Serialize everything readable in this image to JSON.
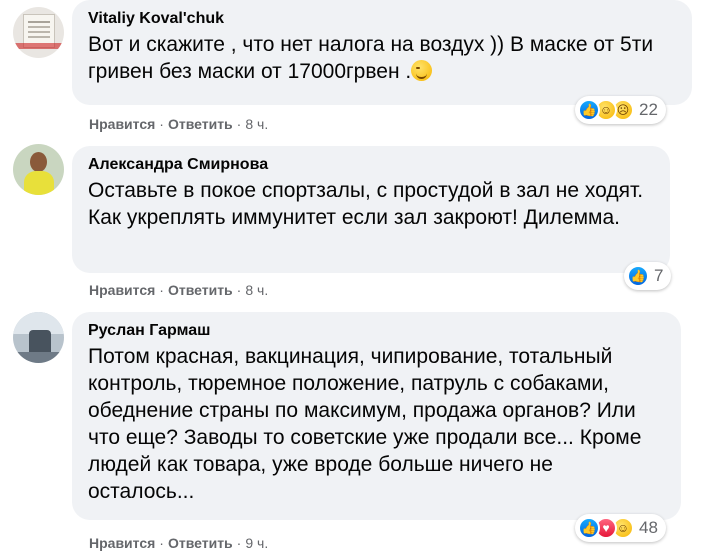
{
  "comments": [
    {
      "author": "Vitaliy Koval'chuk",
      "text": "Вот и скажите , что нет налога на воздух )) В маске от 5ти гривен без маски от 17000грвен .",
      "reaction_count": "22",
      "like_label": "Нравится",
      "reply_label": "Ответить",
      "time": "8 ч."
    },
    {
      "author": "Александра Смирнова",
      "text": "Оставьте в покое спортзалы, с простудой в зал не ходят. Как укреплять иммунитет если зал закроют! Дилемма.",
      "reaction_count": "7",
      "like_label": "Нравится",
      "reply_label": "Ответить",
      "time": "8 ч."
    },
    {
      "author": "Руслан Гармаш",
      "text": "Потом красная, вакцинация, чипирование, тотальный контроль, тюремное положение, патруль с собаками, обеднение страны по максимум, продажа органов? Или что еще? Заводы то советские уже продали все... Кроме людей как товара, уже вроде больше ничего не осталось...",
      "reaction_count": "48",
      "like_label": "Нравится",
      "reply_label": "Ответить",
      "time": "9 ч."
    }
  ],
  "separator": "·",
  "icons": {
    "like": "like-reaction-icon",
    "love": "love-reaction-icon",
    "haha": "haha-reaction-icon",
    "sad": "sad-reaction-icon",
    "wink": "wink-emoji-icon"
  },
  "colors": {
    "bubble": "#f0f2f5",
    "meta": "#65676b",
    "like": "#0165e1",
    "love": "#e61739"
  }
}
